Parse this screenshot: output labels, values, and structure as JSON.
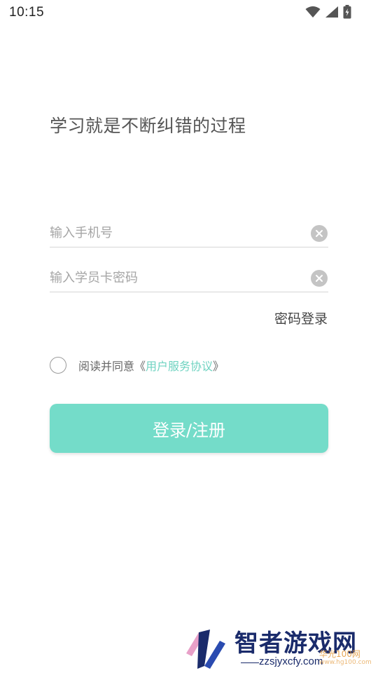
{
  "status_bar": {
    "time": "10:15",
    "icons": [
      "wifi-icon",
      "signal-icon",
      "battery-charging-icon"
    ]
  },
  "slogan": "学习就是不断纠错的过程",
  "form": {
    "phone_placeholder": "输入手机号",
    "password_placeholder": "输入学员卡密码",
    "switch_login_label": "密码登录"
  },
  "agreement": {
    "checked": false,
    "prefix": "阅读并同意",
    "open_bracket": "《",
    "link_label": "用户服务协议",
    "close_bracket": "》"
  },
  "login_button": {
    "label": "登录/注册"
  },
  "watermark": {
    "title": "智者游戏网",
    "domain": "zzsjyxcfy.com",
    "sub": "华光100网",
    "sub_small": "www.hg100.com"
  },
  "colors": {
    "accent": "#74dcc9",
    "link": "#6fd3c1",
    "watermark_primary": "#1a2b6b"
  }
}
